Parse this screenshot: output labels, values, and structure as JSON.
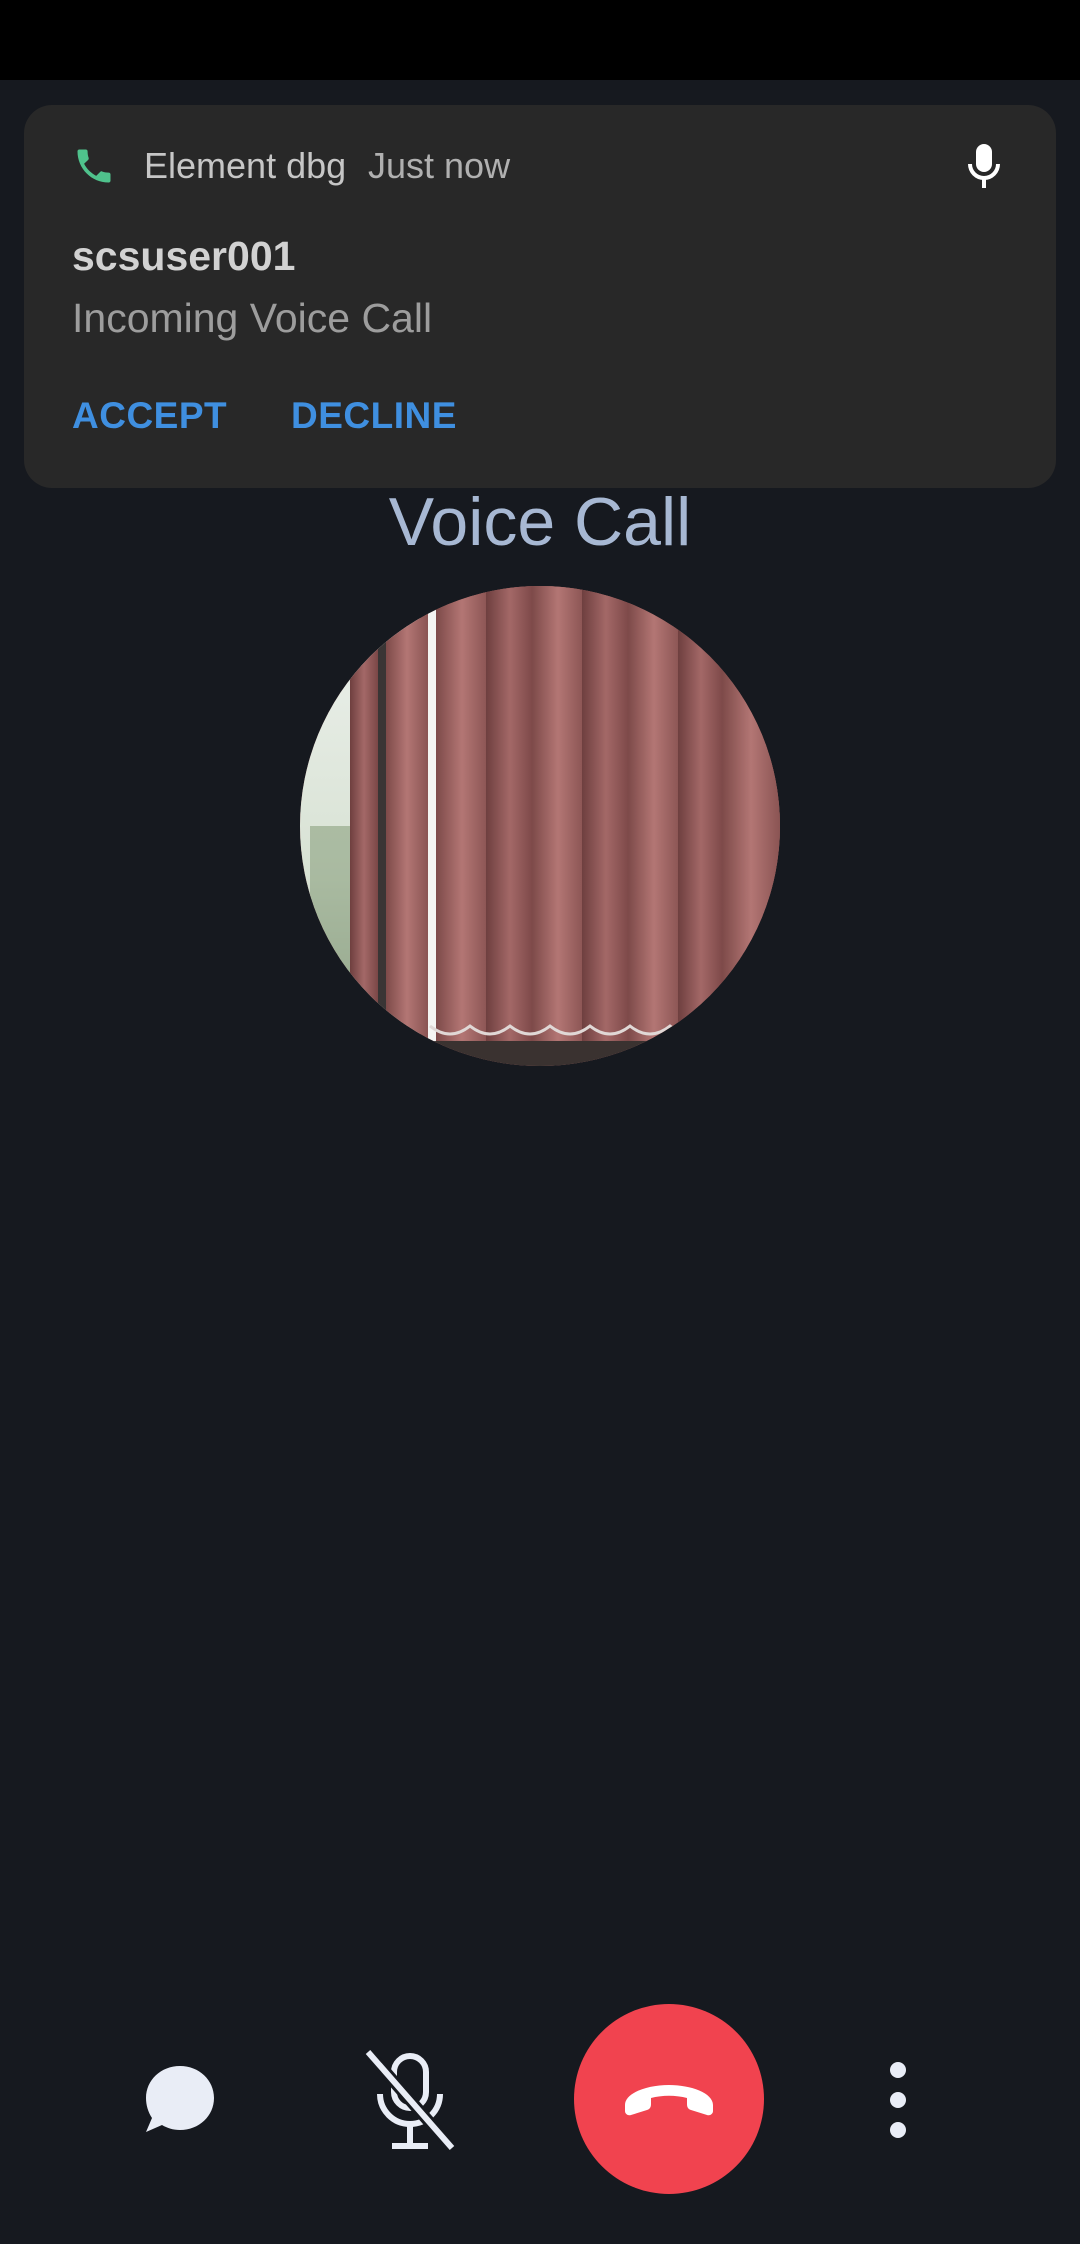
{
  "notification": {
    "app_name": "Element dbg",
    "time": "Just now",
    "title": "scsuser001",
    "text": "Incoming Voice Call",
    "accept_label": "ACCEPT",
    "decline_label": "DECLINE",
    "app_icon": "phone-icon",
    "trailing_icon": "mic-icon"
  },
  "call": {
    "title": "Voice Call"
  },
  "controls": {
    "chat_icon": "chat-bubble-icon",
    "mute_icon": "mic-off-icon",
    "hangup_icon": "hang-up-icon",
    "more_icon": "more-vertical-icon"
  },
  "colors": {
    "background": "#16191f",
    "notification_bg": "#282828",
    "action_blue": "#3f8fe0",
    "phone_green": "#4fc28c",
    "hangup_red": "#f1434f",
    "title_blue_gray": "#a7b8d3"
  }
}
